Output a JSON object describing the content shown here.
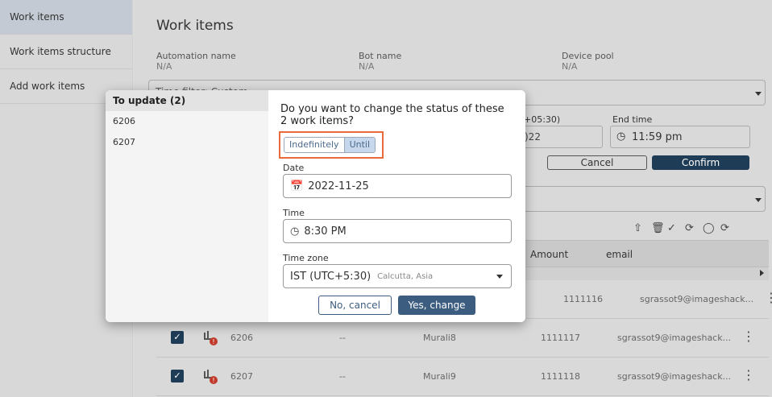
{
  "sidebar": {
    "items": [
      {
        "label": "Work items"
      },
      {
        "label": "Work items structure"
      },
      {
        "label": "Add work items"
      }
    ]
  },
  "main": {
    "title": "Work items",
    "meta": [
      {
        "label": "Automation name",
        "value": "N/A"
      },
      {
        "label": "Bot name",
        "value": "N/A"
      },
      {
        "label": "Device pool",
        "value": "N/A"
      }
    ],
    "time_filter": "Time filter: Custom",
    "end_time_label": "End time",
    "end_time_value": "11:59 pm",
    "tz_partial": "+05:30)",
    "date_partial": ")22",
    "cancel_label": "Cancel",
    "confirm_label": "Confirm"
  },
  "table": {
    "headers": [
      "Amount",
      "email"
    ],
    "rows": [
      {
        "id": "",
        "dash": "",
        "bot": "",
        "amount": "1111116",
        "email": "sgrassot9@imageshack...",
        "checked": false
      },
      {
        "id": "6206",
        "dash": "--",
        "bot": "Murali8",
        "amount": "1111117",
        "email": "sgrassot9@imageshack...",
        "checked": true
      },
      {
        "id": "6207",
        "dash": "--",
        "bot": "Murali9",
        "amount": "1111118",
        "email": "sgrassot9@imageshack...",
        "checked": true
      }
    ]
  },
  "modal": {
    "left_title": "To update (2)",
    "left_items": [
      "6206",
      "6207"
    ],
    "question": "Do you want to change the status of these 2 work items?",
    "seg_options": [
      "Indefinitely",
      "Until"
    ],
    "seg_selected": "Until",
    "date_label": "Date",
    "date_value": "2022-11-25",
    "time_label": "Time",
    "time_value": "8:30 PM",
    "tz_label": "Time zone",
    "tz_value": "IST (UTC+5:30)",
    "tz_sub": "Calcutta, Asia",
    "no_label": "No, cancel",
    "yes_label": "Yes, change"
  },
  "colors": {
    "accent": "#3c5d80",
    "highlight_border": "#e96a3a",
    "error_badge": "#c0392b"
  }
}
